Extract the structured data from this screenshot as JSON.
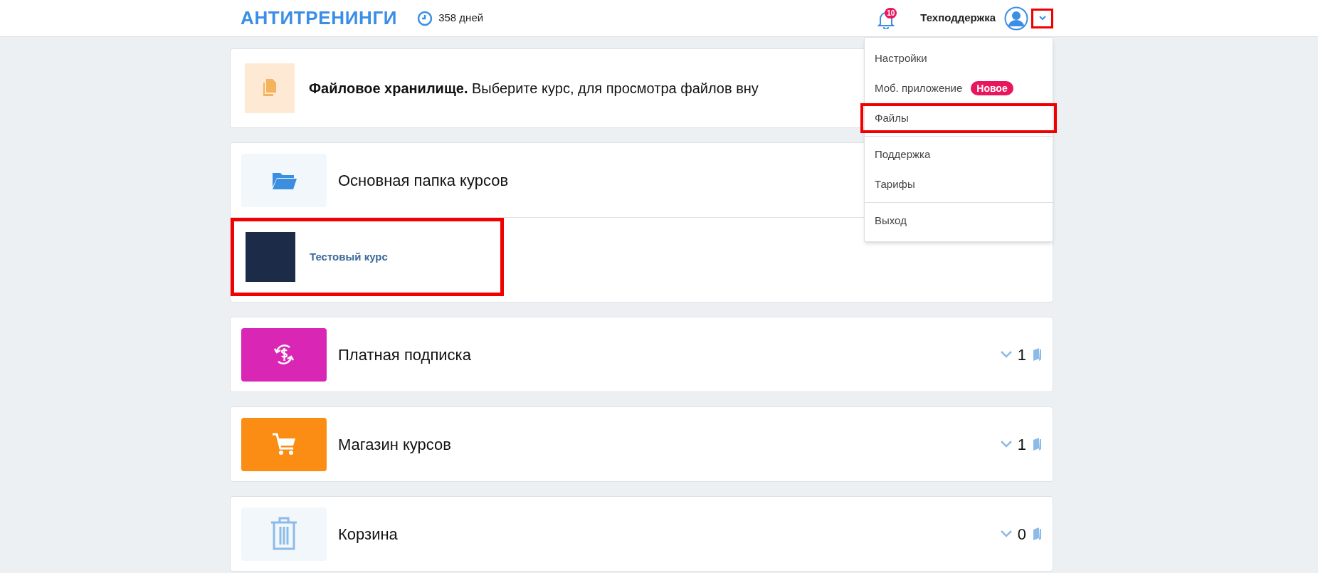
{
  "header": {
    "logo": "АНТИТРЕНИНГИ",
    "days": "358 дней",
    "notifications": "10",
    "user": "Техподдержка",
    "menu_open": true,
    "menu_button_highlighted": true
  },
  "menu": {
    "groups": [
      [
        {
          "label": "Настройки",
          "highlighted": false
        },
        {
          "label": "Моб. приложение",
          "badge": "Новое",
          "highlighted": false
        },
        {
          "label": "Файлы",
          "highlighted": true
        }
      ],
      [
        {
          "label": "Поддержка",
          "highlighted": false
        },
        {
          "label": "Тарифы",
          "highlighted": false
        }
      ],
      [
        {
          "label": "Выход",
          "highlighted": false
        }
      ]
    ]
  },
  "info": {
    "kind": "files",
    "color": "#fde9d4",
    "text": "**Файловое хранилище.** Выберите курс, для просмотра файлов вну"
  },
  "folders": [
    {
      "kind": "folder",
      "color": "#f2f7fc",
      "title": "Основная папка курсов",
      "expanded": true,
      "courses": [
        {
          "title": "Тестовый курс",
          "highlighted": true
        }
      ]
    },
    {
      "kind": "subscription",
      "color": "#d926b5",
      "title": "Платная подписка",
      "expanded": false,
      "count": "1"
    },
    {
      "kind": "shop",
      "color": "#fb8c14",
      "title": "Магазин курсов",
      "expanded": false,
      "count": "1"
    },
    {
      "kind": "trash",
      "color": "#f2f7fc",
      "title": "Корзина",
      "expanded": false,
      "count": "0"
    }
  ]
}
